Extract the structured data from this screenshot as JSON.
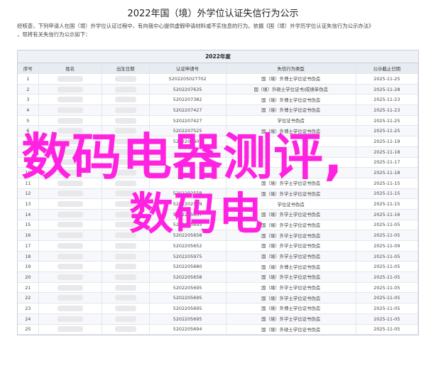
{
  "page": {
    "title": "2022年国（境）外学位认证失信行为公示",
    "intro_lines": [
      "经核查，下列申请人在国（境）外学位认证过程中，有向我中心提供虚假申请材料或不实信息的行为。依据《国（境）外学历学位认证失信行为公示办法》",
      "，现将有关失信行为公示如下："
    ]
  },
  "table": {
    "caption": "2022年度",
    "headers": [
      "序号",
      "姓名",
      "出生日期",
      "认证申请号",
      "失信行为类型",
      "公示截止日期"
    ],
    "rows": [
      {
        "seq": "1",
        "app_no": "5202205027702",
        "type": "国（境）外博士学位证书伪造",
        "deadline": "2025-11-25"
      },
      {
        "seq": "2",
        "app_no": "5202207635",
        "type": "国（境）外硕士学位证书/成绩单伪造",
        "deadline": "2025-11-28"
      },
      {
        "seq": "3",
        "app_no": "5202207382",
        "type": "国（境）外博士学位证书伪造",
        "deadline": "2025-11-23"
      },
      {
        "seq": "4",
        "app_no": "5202207427",
        "type": "国（境）外博士学位证书伪造",
        "deadline": "2025-11-23"
      },
      {
        "seq": "5",
        "app_no": "5202207427",
        "type": "学位证书伪造",
        "deadline": "2025-11-25"
      },
      {
        "seq": "6",
        "app_no": "5202207525",
        "type": "国（境）外博士学位证书伪造",
        "deadline": "2025-11-25"
      },
      {
        "seq": "7",
        "app_no": "5202207607",
        "type": "",
        "deadline": "2025-11-19"
      },
      {
        "seq": "8",
        "app_no": "",
        "type": "",
        "deadline": "2025-11-18"
      },
      {
        "seq": "9",
        "app_no": "",
        "type": "",
        "deadline": "2025-11-17"
      },
      {
        "seq": "10",
        "app_no": "",
        "type": "",
        "deadline": "2025-11-18"
      },
      {
        "seq": "11",
        "app_no": "",
        "type": "国（境）外学士学位证书伪造",
        "deadline": "2025-11-15"
      },
      {
        "seq": "12",
        "app_no": "5202202558",
        "type": "国（境）外学士学位证书伪造",
        "deadline": "2025-11-15"
      },
      {
        "seq": "13",
        "app_no": "5202202559",
        "type": "学位证书伪造",
        "deadline": "2025-11-15"
      },
      {
        "seq": "14",
        "app_no": "5202205657",
        "type": "国（境）外学士学位证书伪造",
        "deadline": "2025-11-16"
      },
      {
        "seq": "15",
        "app_no": "5202205695",
        "type": "国（境）外学士学位证书伪造",
        "deadline": "2025-11-05"
      },
      {
        "seq": "16",
        "app_no": "5202205658",
        "type": "国（境）外学士学位证书伪造",
        "deadline": "2025-11-05"
      },
      {
        "seq": "17",
        "app_no": "5202205652",
        "type": "国（境）外学士学位证书伪造",
        "deadline": "2025-11-09"
      },
      {
        "seq": "18",
        "app_no": "5202205975",
        "type": "国（境）外学士学位证书伪造",
        "deadline": "2025-11-05"
      },
      {
        "seq": "19",
        "app_no": "5202205680",
        "type": "国（境）外博士学位证书伪造",
        "deadline": "2025-11-05"
      },
      {
        "seq": "20",
        "app_no": "5202205658",
        "type": "国（境）外学士学位证书伪造",
        "deadline": "2025-11-05"
      },
      {
        "seq": "21",
        "app_no": "5202205695",
        "type": "国（境）外学士学位证书伪造",
        "deadline": "2025-11-05"
      },
      {
        "seq": "22",
        "app_no": "5202205695",
        "type": "国（境）外学士学位证书伪造",
        "deadline": "2025-11-05"
      },
      {
        "seq": "23",
        "app_no": "5202205695",
        "type": "国（境）外博士学位证书伪造",
        "deadline": "2025-11-05"
      },
      {
        "seq": "24",
        "app_no": "5202205695",
        "type": "国（境）外学士学位证书伪造",
        "deadline": "2025-11-05"
      },
      {
        "seq": "25",
        "app_no": "5202205694",
        "type": "国（境）外硕士学位证书伪造",
        "deadline": "2025-11-05"
      }
    ]
  },
  "watermark": {
    "line1": "数码电器测评,",
    "line2": "数码电",
    "color": "#ff22e0"
  }
}
